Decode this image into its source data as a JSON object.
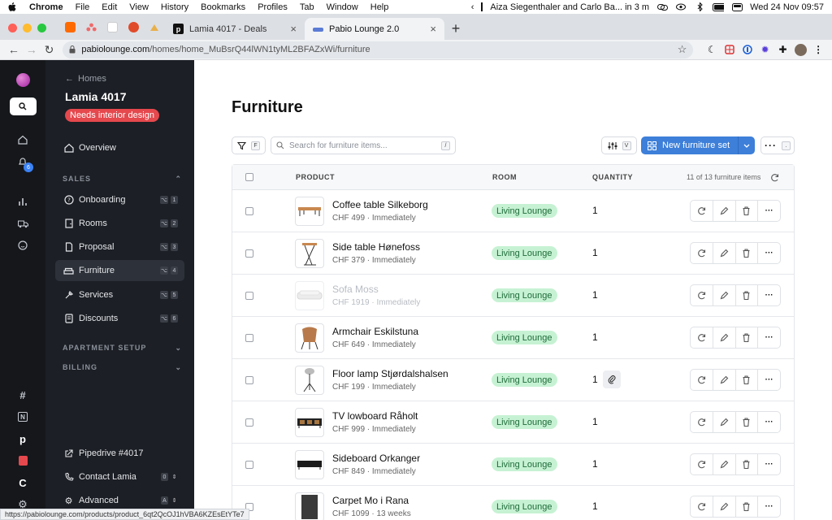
{
  "menubar": {
    "app": "Chrome",
    "items": [
      "File",
      "Edit",
      "View",
      "History",
      "Bookmarks",
      "Profiles",
      "Tab",
      "Window",
      "Help"
    ],
    "calendar_event": "Aiza Siegenthaler and Carlo Ba... in 3 m",
    "datetime": "Wed 24 Nov  09:57"
  },
  "browser": {
    "tabs": [
      {
        "title": "Lamia 4017 - Deals"
      },
      {
        "title": "Pabio Lounge 2.0"
      }
    ],
    "url_host": "pabiolounge.com",
    "url_path": "/homes/home_MuBsrQ44lWN1tyML2BFAZxWi/furniture",
    "status_url": "https://pabiolounge.com/products/product_6qt2QcOJ1hVBA6KZEsEtYTe7"
  },
  "rail": {
    "notification_count": "6"
  },
  "nav": {
    "back_label": "Homes",
    "home_title": "Lamia 4017",
    "status_badge": "Needs interior design",
    "overview": "Overview",
    "sales_header": "SALES",
    "items": [
      {
        "label": "Onboarding",
        "shortcut": "1"
      },
      {
        "label": "Rooms",
        "shortcut": "2"
      },
      {
        "label": "Proposal",
        "shortcut": "3"
      },
      {
        "label": "Furniture",
        "shortcut": "4"
      },
      {
        "label": "Services",
        "shortcut": "5"
      },
      {
        "label": "Discounts",
        "shortcut": "6"
      }
    ],
    "apartment_setup_header": "APARTMENT SETUP",
    "billing_header": "BILLING",
    "pipedrive_link": "Pipedrive #4017",
    "contact_label": "Contact Lamia",
    "contact_shortcut": "0",
    "advanced_label": "Advanced",
    "advanced_shortcut": "A"
  },
  "main": {
    "title": "Furniture",
    "filter_shortcut": "F",
    "search_placeholder": "Search for furniture items...",
    "search_shortcut": "/",
    "view_shortcut": "V",
    "new_button": "New furniture set",
    "more_shortcut": "."
  },
  "table": {
    "headers": {
      "product": "PRODUCT",
      "room": "ROOM",
      "quantity": "QUANTITY",
      "count": "11 of 13 furniture items"
    },
    "rows": [
      {
        "name": "Coffee table Silkeborg",
        "meta": "CHF 499 · Immediately",
        "room": "Living Lounge",
        "qty": "1"
      },
      {
        "name": "Side table Hønefoss",
        "meta": "CHF 379 · Immediately",
        "room": "Living Lounge",
        "qty": "1"
      },
      {
        "name": "Sofa Moss",
        "meta": "CHF 1919 · Immediately",
        "room": "Living Lounge",
        "qty": "1"
      },
      {
        "name": "Armchair Eskilstuna",
        "meta": "CHF 649 · Immediately",
        "room": "Living Lounge",
        "qty": "1"
      },
      {
        "name": "Floor lamp Stjørdalshalsen",
        "meta": "CHF 199 · Immediately",
        "room": "Living Lounge",
        "qty": "1"
      },
      {
        "name": "TV lowboard Råholt",
        "meta": "CHF 999 · Immediately",
        "room": "Living Lounge",
        "qty": "1"
      },
      {
        "name": "Sideboard Orkanger",
        "meta": "CHF 849 · Immediately",
        "room": "Living Lounge",
        "qty": "1"
      },
      {
        "name": "Carpet Mo i Rana",
        "meta": "CHF 1099 · 13 weeks",
        "room": "Living Lounge",
        "qty": "1"
      }
    ]
  }
}
